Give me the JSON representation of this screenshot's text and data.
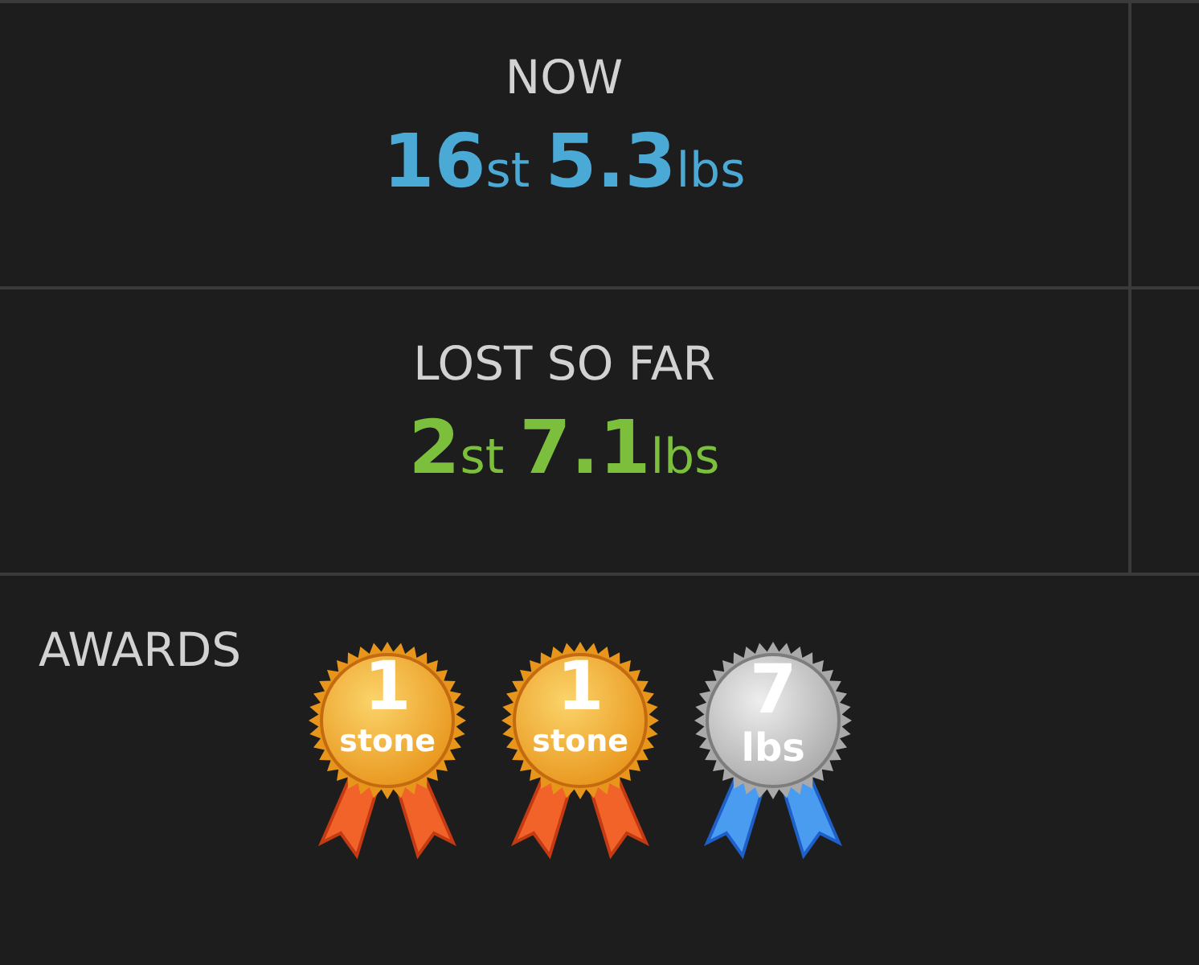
{
  "stats": [
    {
      "label": "NOW",
      "value": "**16**st **5.3**lbs",
      "color": "#4ba9d6"
    },
    {
      "label": "LOST SO FAR",
      "value": "**2**st **7.1**lbs",
      "color": "#7cbf3c"
    }
  ],
  "awards": {
    "label": "AWARDS",
    "medals": [
      {
        "kind": "gold",
        "number": "1",
        "unit": "stone"
      },
      {
        "kind": "gold",
        "number": "1",
        "unit": "stone"
      },
      {
        "kind": "silver",
        "number": "7",
        "unit": "lbs"
      }
    ]
  }
}
